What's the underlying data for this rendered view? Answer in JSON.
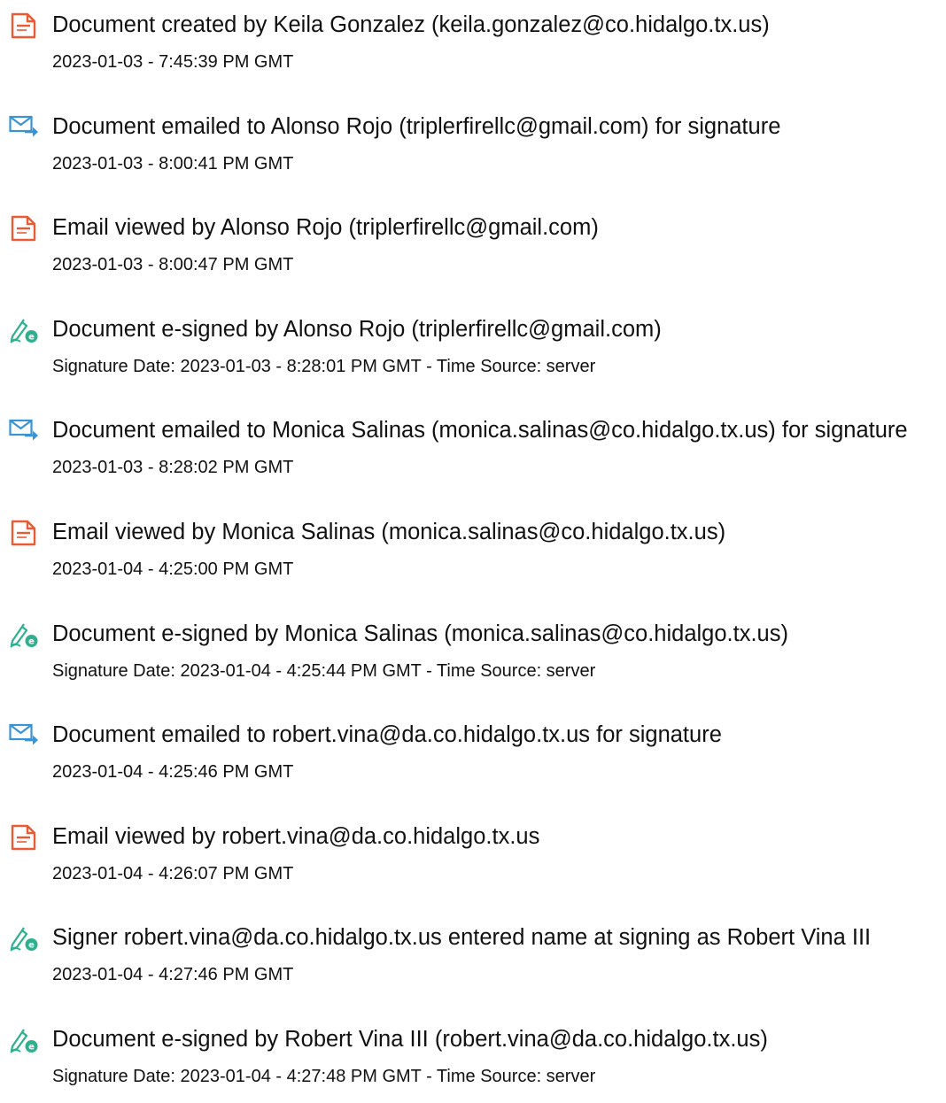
{
  "icon_colors": {
    "document-created-icon": "#ea5a33",
    "email-viewed-icon": "#ea5a33",
    "email-sent-icon": "#3a93d5",
    "e-sign-icon": "#2eb08e"
  },
  "events": [
    {
      "icon": "document-created-icon",
      "title": "Document created by Keila Gonzalez (keila.gonzalez@co.hidalgo.tx.us)",
      "timestamp": "2023-01-03 - 7:45:39 PM GMT"
    },
    {
      "icon": "email-sent-icon",
      "title": "Document emailed to Alonso Rojo (triplerfirellc@gmail.com) for signature",
      "timestamp": "2023-01-03 - 8:00:41 PM GMT"
    },
    {
      "icon": "email-viewed-icon",
      "title": "Email viewed by Alonso Rojo (triplerfirellc@gmail.com)",
      "timestamp": "2023-01-03 - 8:00:47 PM GMT"
    },
    {
      "icon": "e-sign-icon",
      "title": "Document e-signed by Alonso Rojo (triplerfirellc@gmail.com)",
      "timestamp": "Signature Date: 2023-01-03 - 8:28:01 PM GMT - Time Source: server"
    },
    {
      "icon": "email-sent-icon",
      "title": "Document emailed to Monica Salinas (monica.salinas@co.hidalgo.tx.us) for signature",
      "timestamp": "2023-01-03 - 8:28:02 PM GMT"
    },
    {
      "icon": "email-viewed-icon",
      "title": "Email viewed by Monica Salinas (monica.salinas@co.hidalgo.tx.us)",
      "timestamp": "2023-01-04 - 4:25:00 PM GMT"
    },
    {
      "icon": "e-sign-icon",
      "title": "Document e-signed by Monica Salinas (monica.salinas@co.hidalgo.tx.us)",
      "timestamp": "Signature Date: 2023-01-04 - 4:25:44 PM GMT - Time Source: server"
    },
    {
      "icon": "email-sent-icon",
      "title": "Document emailed to robert.vina@da.co.hidalgo.tx.us for signature",
      "timestamp": "2023-01-04 - 4:25:46 PM GMT"
    },
    {
      "icon": "email-viewed-icon",
      "title": "Email viewed by robert.vina@da.co.hidalgo.tx.us",
      "timestamp": "2023-01-04 - 4:26:07 PM GMT"
    },
    {
      "icon": "e-sign-icon",
      "title": "Signer robert.vina@da.co.hidalgo.tx.us entered name at signing as Robert Vina III",
      "timestamp": "2023-01-04 - 4:27:46 PM GMT"
    },
    {
      "icon": "e-sign-icon",
      "title": "Document e-signed by Robert Vina III (robert.vina@da.co.hidalgo.tx.us)",
      "timestamp": "Signature Date: 2023-01-04 - 4:27:48 PM GMT - Time Source: server"
    }
  ]
}
